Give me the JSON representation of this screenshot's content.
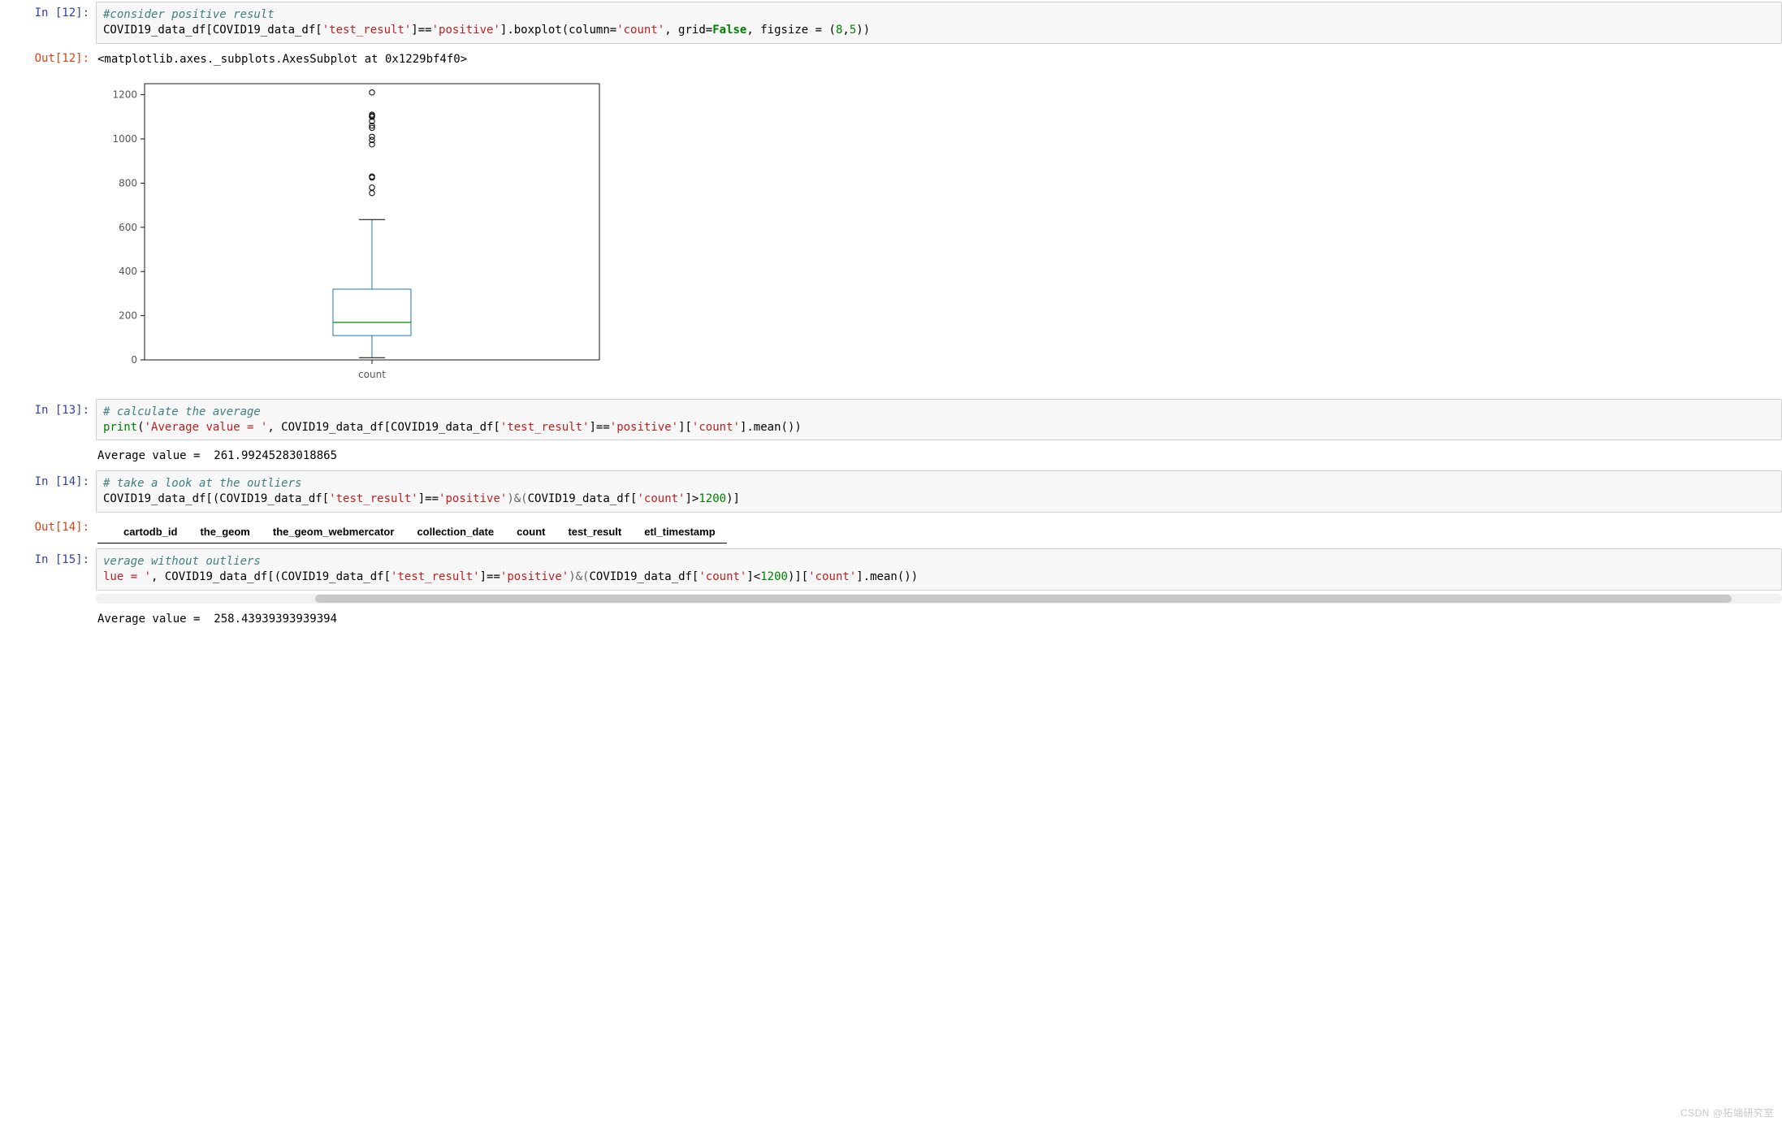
{
  "cells": {
    "c12": {
      "in_prompt": "In [12]:",
      "out_prompt": "Out[12]:",
      "code": {
        "comment": "#consider positive result",
        "line2_a": "COVID19_data_df[COVID19_data_df[",
        "s_test": "'test_result'",
        "line2_b": "]==",
        "s_pos": "'positive'",
        "line2_c": "].boxplot(column=",
        "s_count": "'count'",
        "line2_d": ", grid=",
        "k_false": "False",
        "line2_e": ", figsize = (",
        "m_8": "8",
        "line2_f": ",",
        "m_5": "5",
        "line2_g": "))"
      },
      "out_text": "<matplotlib.axes._subplots.AxesSubplot at 0x1229bf4f0>"
    },
    "c13": {
      "in_prompt": "In [13]:",
      "code": {
        "comment": "# calculate the average",
        "print": "print",
        "p_open": "(",
        "s_avg": "'Average value = '",
        "rest_a": ", COVID19_data_df[COVID19_data_df[",
        "s_test": "'test_result'",
        "rest_b": "]==",
        "s_pos": "'positive'",
        "rest_c": "][",
        "s_count": "'count'",
        "rest_d": "].mean())"
      },
      "out_text": "Average value =  261.99245283018865"
    },
    "c14": {
      "in_prompt": "In [14]:",
      "out_prompt": "Out[14]:",
      "code": {
        "comment": "# take a look at the outliers",
        "a": "COVID19_data_df[(COVID19_data_df[",
        "s_test": "'test_result'",
        "b": "]==",
        "s_pos": "'positive'",
        "amp": ")&(",
        "c": "COVID19_data_df[",
        "s_count": "'count'",
        "d": "]>",
        "m_1200": "1200",
        "e": ")]"
      },
      "columns": [
        "cartodb_id",
        "the_geom",
        "the_geom_webmercator",
        "collection_date",
        "count",
        "test_result",
        "etl_timestamp"
      ]
    },
    "c15": {
      "in_prompt": "In [15]:",
      "code": {
        "comment": "verage without outliers",
        "a": "lue = '",
        "b": ", COVID19_data_df[(COVID19_data_df[",
        "s_test": "'test_result'",
        "c": "]==",
        "s_pos": "'positive'",
        "amp": ")&(",
        "d": "COVID19_data_df[",
        "s_count": "'count'",
        "e": "]<",
        "m_1200": "1200",
        "f": ")][",
        "s_count2": "'count'",
        "g": "].mean())"
      },
      "out_text": "Average value =  258.43939393939394"
    }
  },
  "chart_data": {
    "type": "boxplot",
    "title": "",
    "xlabel": "count",
    "ylabel": "",
    "ylim": [
      0,
      1250
    ],
    "yticks": [
      0,
      200,
      400,
      600,
      800,
      1000,
      1200
    ],
    "series": [
      {
        "name": "count",
        "q1": 110,
        "median": 170,
        "q3": 320,
        "whisker_low": 10,
        "whisker_high": 635,
        "outliers": [
          755,
          780,
          825,
          830,
          975,
          995,
          1010,
          1050,
          1060,
          1080,
          1100,
          1105,
          1110,
          1210
        ]
      }
    ]
  },
  "watermark": "CSDN @拓端研究室"
}
